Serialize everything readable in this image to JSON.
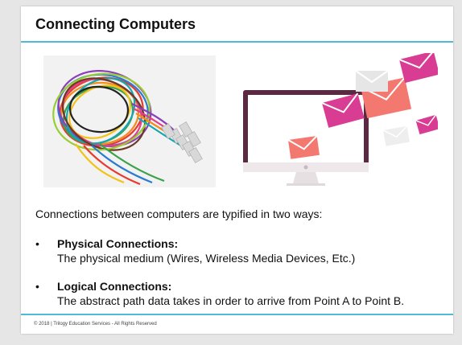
{
  "slide": {
    "title": "Connecting Computers",
    "intro": "Connections between computers are typified in two ways:",
    "bullets": [
      {
        "marker": "•",
        "heading": "Physical Connections:",
        "description": "The physical medium (Wires, Wireless Media Devices, Etc.)"
      },
      {
        "marker": "•",
        "heading": "Logical Connections:",
        "description": "The abstract path data takes in order to arrive from Point A to Point B."
      }
    ],
    "footer": "© 2018 | Trilogy Education Services - All Rights Reserved"
  },
  "images": {
    "left": "colorful-cables-image",
    "right": "monitor-with-envelopes-illustration"
  },
  "colors": {
    "accent_rule": "#4fb9d8",
    "envelope_magenta": "#d83d93",
    "envelope_salmon": "#f3786f",
    "monitor_frame": "#5a2a42"
  }
}
